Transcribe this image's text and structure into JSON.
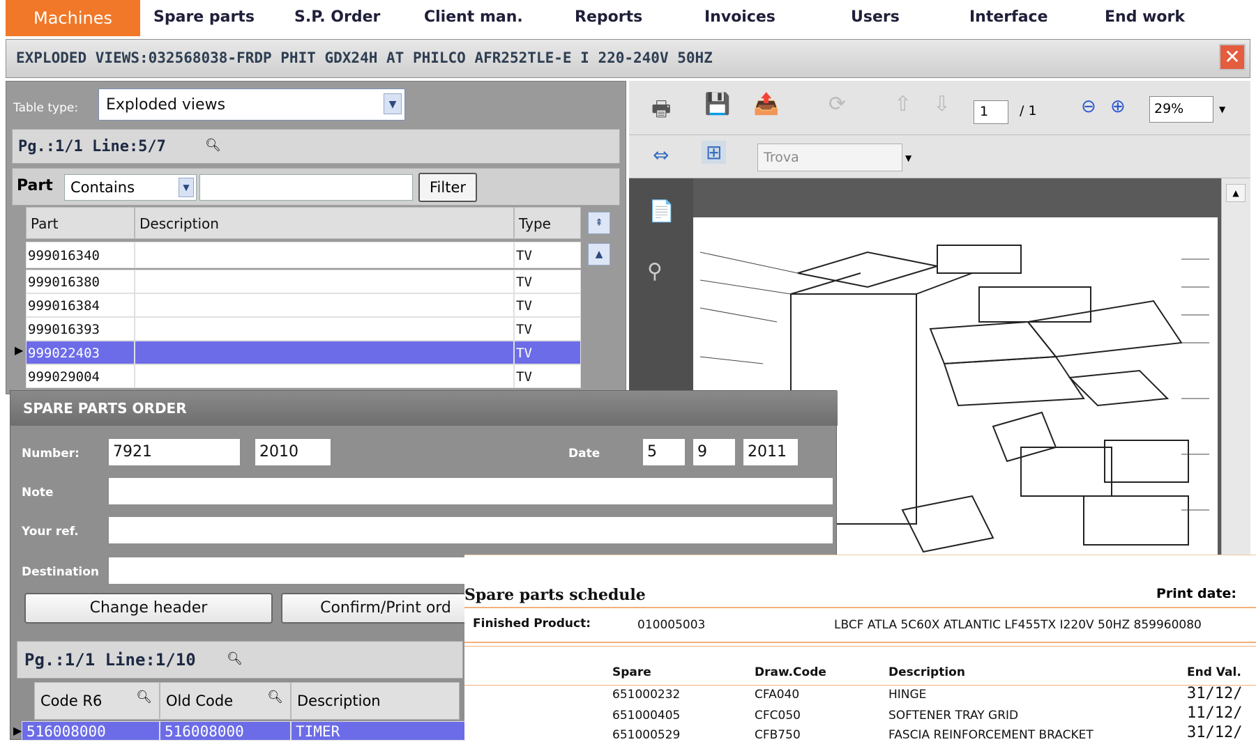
{
  "menu": [
    "Machines",
    "Spare parts",
    "S.P. Order",
    "Client man.",
    "Reports",
    "Invoices",
    "Users",
    "Interface",
    "End work"
  ],
  "window_title": "EXPLODED VIEWS:032568038-FRDP PHIT GDX24H AT PHILCO AFR252TLE-E I 220-240V 50HZ",
  "close_symbol": "✕",
  "left": {
    "table_type_label": "Table type:",
    "table_type_value": "Exploded views",
    "pager": "Pg.:1/1  Line:5/7",
    "filter_label": "Part",
    "filter_op": "Contains",
    "filter_value": "",
    "filter_button": "Filter",
    "columns": [
      "Part",
      "Description",
      "Type"
    ],
    "rows": [
      {
        "part": "999016340",
        "desc": "",
        "type": "TV"
      },
      {
        "part": "999016380",
        "desc": "",
        "type": "TV"
      },
      {
        "part": "999016384",
        "desc": "",
        "type": "TV"
      },
      {
        "part": "999016393",
        "desc": "",
        "type": "TV"
      },
      {
        "part": "999022403",
        "desc": "",
        "type": "TV"
      },
      {
        "part": "999029004",
        "desc": "",
        "type": "TV"
      }
    ]
  },
  "viewer": {
    "page_current": "1",
    "page_total": "/ 1",
    "zoom": "29%",
    "find_placeholder": "Trova"
  },
  "order": {
    "title": "SPARE PARTS ORDER",
    "number_label": "Number:",
    "number": "7921",
    "year": "2010",
    "date_label": "Date",
    "date_day": "5",
    "date_month": "9",
    "date_year": "2011",
    "note_label": "Note",
    "ref_label": "Your ref.",
    "dest_label": "Destination",
    "btn_change": "Change header",
    "btn_confirm": "Confirm/Print ord",
    "pager": "Pg.:1/1  Line:1/10",
    "columns": [
      "Code R6",
      "Old Code",
      "Description"
    ],
    "row": {
      "code": "516008000",
      "old": "516008000",
      "desc": "TIMER"
    }
  },
  "schedule": {
    "title": "Spare parts schedule",
    "print_date_label": "Print date:",
    "fp_label": "Finished Product:",
    "fp_code": "010005003",
    "fp_desc": "LBCF ATLA 5C60X ATLANTIC LF455TX I220V 50HZ 859960080",
    "columns": [
      "Spare",
      "Draw.Code",
      "Description",
      "End Val."
    ],
    "rows": [
      {
        "spare": "651000232",
        "draw": "CFA040",
        "desc": "HINGE",
        "end": "31/12/"
      },
      {
        "spare": "651000405",
        "draw": "CFC050",
        "desc": "SOFTENER TRAY GRID",
        "end": "11/12/"
      },
      {
        "spare": "651000529",
        "draw": "CFB750",
        "desc": "FASCIA REINFORCEMENT BRACKET",
        "end": "31/12/"
      }
    ]
  }
}
